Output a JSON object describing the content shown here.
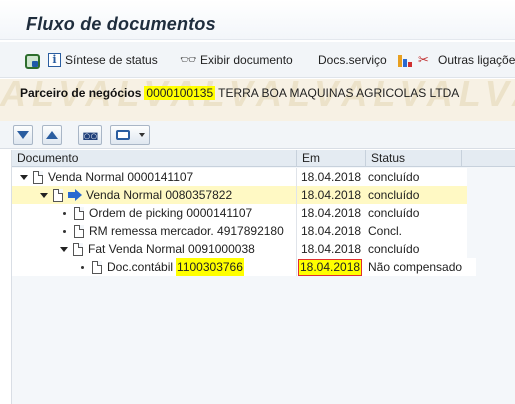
{
  "window": {
    "title": "Fluxo de documentos"
  },
  "app_toolbar": {
    "status_overview": "Síntese de status",
    "display_document": "Exibir documento",
    "service_docs": "Docs.serviço",
    "other_links": "Outras ligações"
  },
  "watermark": "ALVALVALVALVALVALVALV",
  "partner": {
    "label": "Parceiro de negócios",
    "number": "0000100135",
    "name": "TERRA BOA MAQUINAS AGRICOLAS LTDA"
  },
  "grid": {
    "columns": {
      "document": "Documento",
      "date": "Em",
      "status": "Status"
    },
    "rows": [
      {
        "doc": "Venda Normal 0000141107",
        "date": "18.04.2018",
        "status": "concluído"
      },
      {
        "doc": "Venda Normal 0080357822",
        "date": "18.04.2018",
        "status": "concluído"
      },
      {
        "doc": "Ordem de picking 0000141107",
        "date": "18.04.2018",
        "status": "concluído"
      },
      {
        "doc": "RM remessa mercador. 4917892180",
        "date": "18.04.2018",
        "status": "Concl."
      },
      {
        "doc": "Fat Venda Normal 0091000038",
        "date": "18.04.2018",
        "status": "concluído"
      },
      {
        "doc_label": "Doc.contábil",
        "doc_number": "1100303766",
        "date": "18.04.2018",
        "status": "Não compensado"
      }
    ]
  },
  "colors": {
    "highlight": "#ffff00",
    "selection": "#fff9c4",
    "accent": "#2a5da0"
  }
}
